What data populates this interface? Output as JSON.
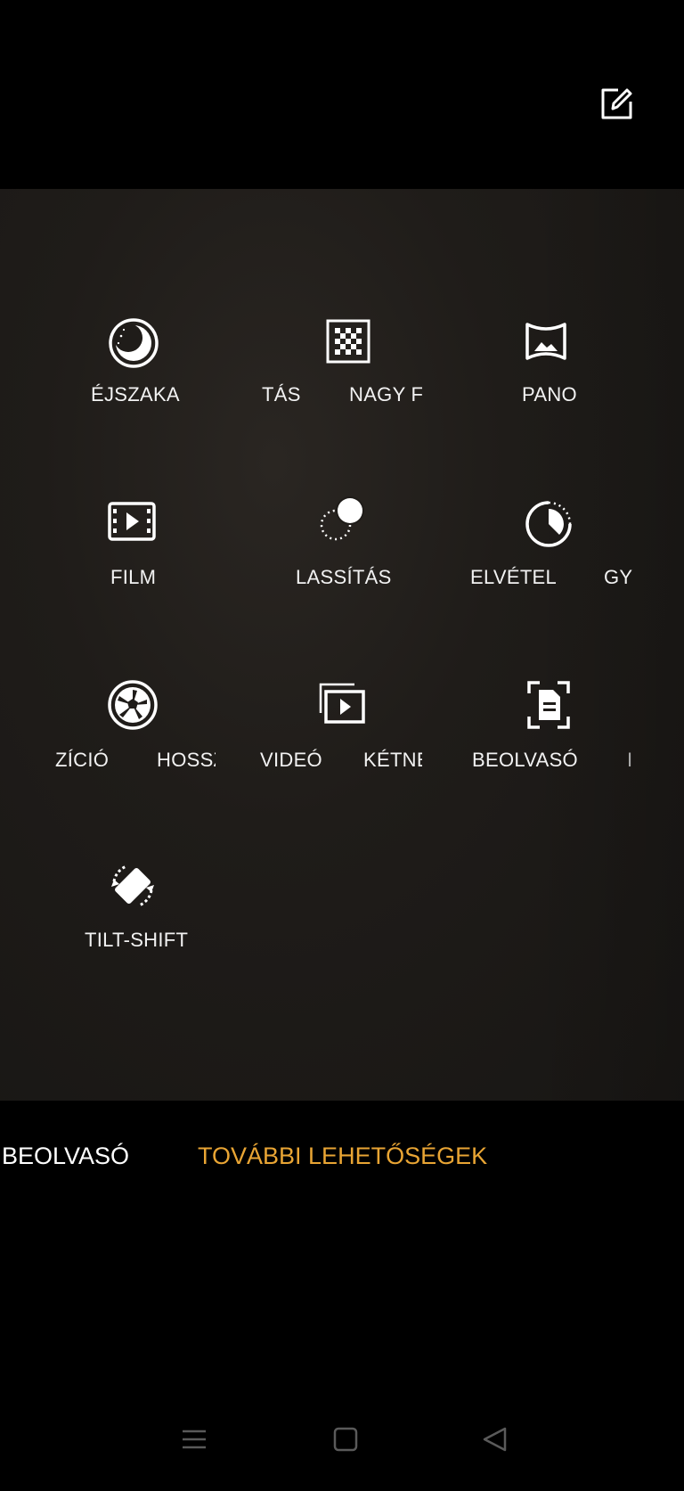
{
  "header": {
    "edit_icon": "edit-icon"
  },
  "modes": {
    "row1": {
      "night": "ÉJSZAKA",
      "tas_partial": "TÁS",
      "nagy_partial": "NAGY F",
      "pano": "PANO"
    },
    "row2": {
      "film": "FILM",
      "lassitas": "LASSÍTÁS",
      "elvetel_partial": "ELVÉTEL",
      "gy_partial": "GY"
    },
    "row3": {
      "zicio_partial": "ZÍCIÓ",
      "hossz_partial": "HOSSZ",
      "video_partial": "VIDEÓ",
      "ketne_partial": "KÉTNE",
      "beolvaso_partial": "BEOLVASÓ",
      "tail_partial": "I"
    },
    "row4": {
      "tiltshift": "TILT-SHIFT"
    }
  },
  "bottom_tabs": {
    "prev_partial": "BEOLVASÓ",
    "active": "TOVÁBBI LEHETŐSÉGEK"
  },
  "colors": {
    "active_tab": "#e9a534",
    "text": "#f2f2f2",
    "nav": "#5a5a5a"
  },
  "nav_icons": [
    "menu-icon",
    "home-icon",
    "back-icon"
  ]
}
